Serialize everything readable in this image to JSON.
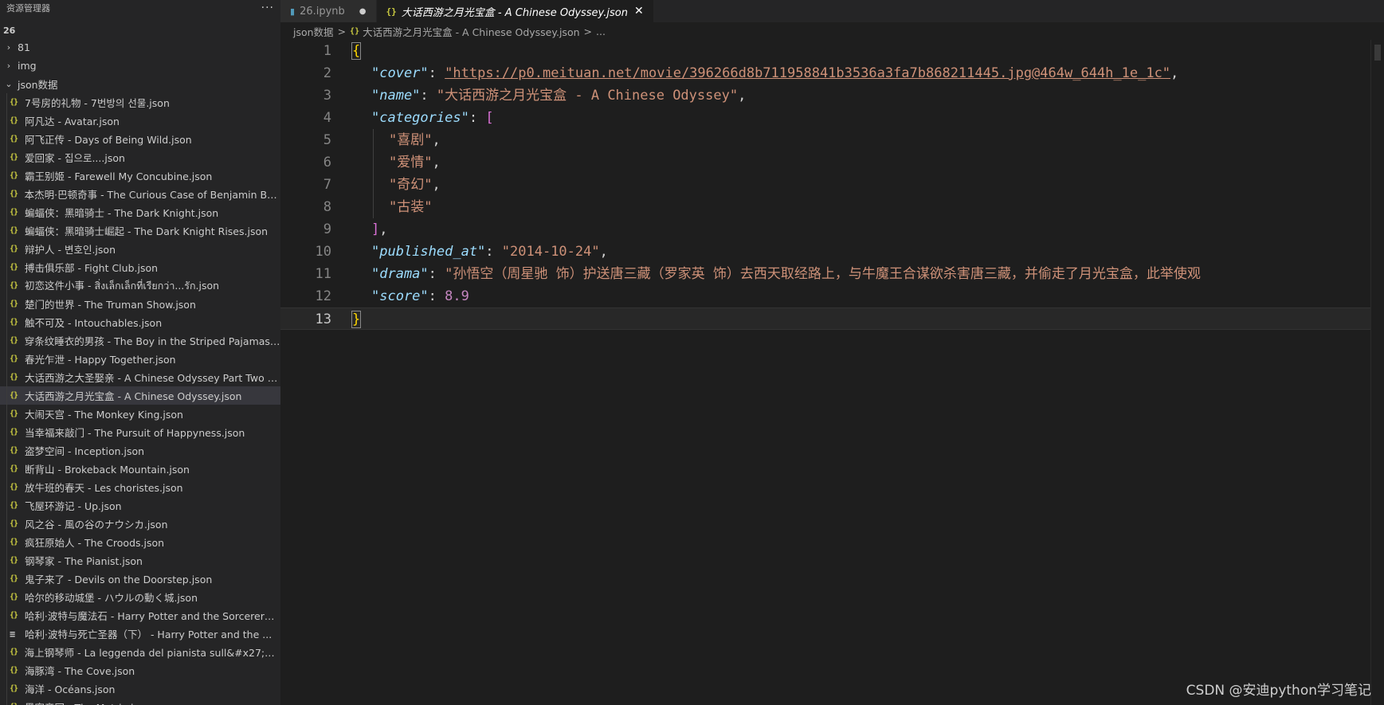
{
  "sidebar": {
    "title": "资源管理器",
    "more": "···",
    "workspace": "26",
    "folders": [
      {
        "label": "81",
        "chevron": "›"
      },
      {
        "label": "img",
        "chevron": "›"
      },
      {
        "label": "json数据",
        "chevron": "⌄"
      }
    ],
    "files": [
      {
        "label": "7号房的礼物 - 7번방의 선물.json",
        "icon": "{}"
      },
      {
        "label": "阿凡达 - Avatar.json",
        "icon": "{}"
      },
      {
        "label": "阿飞正传 - Days of Being Wild.json",
        "icon": "{}"
      },
      {
        "label": "爱回家 - 집으로....json",
        "icon": "{}"
      },
      {
        "label": "霸王别姬 - Farewell My Concubine.json",
        "icon": "{}"
      },
      {
        "label": "本杰明·巴顿奇事 - The Curious Case of Benjamin But...",
        "icon": "{}"
      },
      {
        "label": "蝙蝠侠：黑暗骑士 - The Dark Knight.json",
        "icon": "{}"
      },
      {
        "label": "蝙蝠侠：黑暗骑士崛起 - The Dark Knight Rises.json",
        "icon": "{}"
      },
      {
        "label": "辩护人 - 변호인.json",
        "icon": "{}"
      },
      {
        "label": "搏击俱乐部 - Fight Club.json",
        "icon": "{}"
      },
      {
        "label": "初恋这件小事 - สิ่งเล็กเล็กที่เรียกว่า...รัก.json",
        "icon": "{}"
      },
      {
        "label": "楚门的世界 - The Truman Show.json",
        "icon": "{}"
      },
      {
        "label": "触不可及 - Intouchables.json",
        "icon": "{}"
      },
      {
        "label": "穿条纹睡衣的男孩 - The Boy in the Striped Pajamas.j...",
        "icon": "{}"
      },
      {
        "label": "春光乍泄 - Happy Together.json",
        "icon": "{}"
      },
      {
        "label": "大话西游之大圣娶亲 - A Chinese Odyssey Part Two -...",
        "icon": "{}"
      },
      {
        "label": "大话西游之月光宝盒 - A Chinese Odyssey.json",
        "icon": "{}",
        "active": true
      },
      {
        "label": "大闹天宫 - The Monkey King.json",
        "icon": "{}"
      },
      {
        "label": "当幸福来敲门 - The Pursuit of Happyness.json",
        "icon": "{}"
      },
      {
        "label": "盗梦空间 - Inception.json",
        "icon": "{}"
      },
      {
        "label": "断背山 - Brokeback Mountain.json",
        "icon": "{}"
      },
      {
        "label": "放牛班的春天 - Les choristes.json",
        "icon": "{}"
      },
      {
        "label": "飞屋环游记 - Up.json",
        "icon": "{}"
      },
      {
        "label": "风之谷 - 風の谷のナウシカ.json",
        "icon": "{}"
      },
      {
        "label": "疯狂原始人 - The Croods.json",
        "icon": "{}"
      },
      {
        "label": "钢琴家 - The Pianist.json",
        "icon": "{}"
      },
      {
        "label": "鬼子来了 - Devils on the Doorstep.json",
        "icon": "{}"
      },
      {
        "label": "哈尔的移动城堡 - ハウルの動く城.json",
        "icon": "{}"
      },
      {
        "label": "哈利·波特与魔法石 - Harry Potter and the Sorcerer&...",
        "icon": "{}"
      },
      {
        "label": "哈利·波特与死亡圣器（下） - Harry Potter and the ...",
        "icon": "≡"
      },
      {
        "label": "海上钢琴师 - La leggenda del pianista sull&#x27;oc...",
        "icon": "{}"
      },
      {
        "label": "海豚湾 - The Cove.json",
        "icon": "{}"
      },
      {
        "label": "海洋 - Océans.json",
        "icon": "{}"
      },
      {
        "label": "黑客帝国 - The Matrix.json",
        "icon": "{}"
      }
    ]
  },
  "tabs": [
    {
      "label": "26.ipynb",
      "icon": "notebook-icon",
      "modified": "●"
    },
    {
      "label": "大话西游之月光宝盒 - A Chinese Odyssey.json",
      "icon": "{}",
      "close": "✕"
    }
  ],
  "breadcrumb": {
    "folder": "json数据",
    "sep": ">",
    "icon": "{}",
    "file": "大话西游之月光宝盒 - A Chinese Odyssey.json",
    "more": "..."
  },
  "editor": {
    "line_numbers": [
      "1",
      "2",
      "3",
      "4",
      "5",
      "6",
      "7",
      "8",
      "9",
      "10",
      "11",
      "12",
      "13"
    ],
    "open_brace": "{",
    "close_brace": "}",
    "cover_key": "\"cover\"",
    "cover_value": "\"https://p0.meituan.net/movie/396266d8b711958841b3536a3fa7b868211445.jpg@464w_644h_1e_1c\"",
    "name_key": "\"name\"",
    "name_value": "\"大话西游之月光宝盒 - A Chinese Odyssey\"",
    "categories_key": "\"categories\"",
    "open_bracket": "[",
    "close_bracket": "]",
    "categories": [
      "\"喜剧\"",
      "\"爱情\"",
      "\"奇幻\"",
      "\"古装\""
    ],
    "published_key": "\"published_at\"",
    "published_value": "\"2014-10-24\"",
    "drama_key": "\"drama\"",
    "drama_value": "\"孙悟空（周星驰 饰）护送唐三藏（罗家英 饰）去西天取经路上，与牛魔王合谋欲杀害唐三藏，并偷走了月光宝盒，此举使观",
    "score_key": "\"score\"",
    "score_value": "8.9"
  },
  "watermark": "CSDN @安迪python学习笔记"
}
